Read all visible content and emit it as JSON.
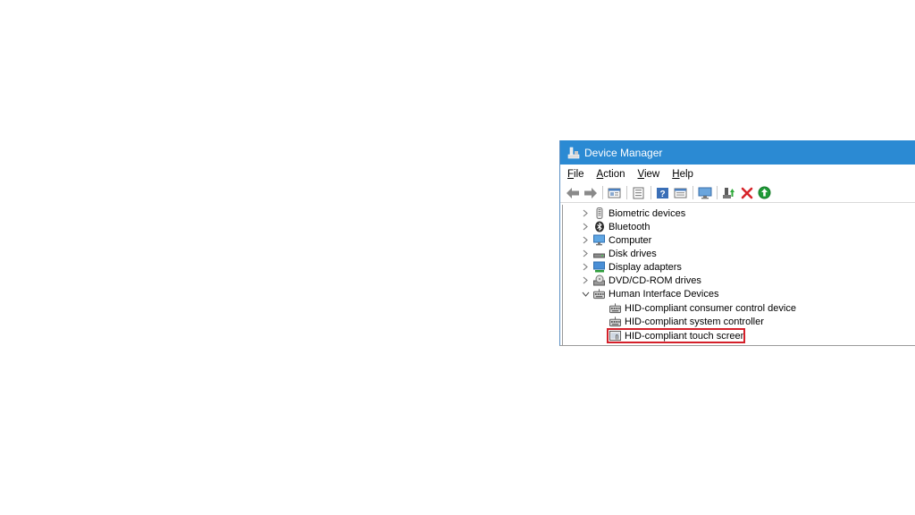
{
  "window": {
    "title": "Device Manager"
  },
  "menu": [
    {
      "accel": "F",
      "rest": "ile"
    },
    {
      "accel": "A",
      "rest": "ction"
    },
    {
      "accel": "V",
      "rest": "iew"
    },
    {
      "accel": "H",
      "rest": "elp"
    }
  ],
  "toolbar": [
    "back-arrow-icon",
    "forward-arrow-icon",
    "properties-view-icon",
    "update-list-icon",
    "help-icon",
    "device-view-icon",
    "monitor-scan-icon",
    "update-driver-icon",
    "uninstall-x-icon",
    "enable-device-icon"
  ],
  "tree": [
    {
      "label": "Biometric devices",
      "expanded": false,
      "level": 0,
      "icon": "biometric-icon"
    },
    {
      "label": "Bluetooth",
      "expanded": false,
      "level": 0,
      "icon": "bluetooth-icon"
    },
    {
      "label": "Computer",
      "expanded": false,
      "level": 0,
      "icon": "computer-icon"
    },
    {
      "label": "Disk drives",
      "expanded": false,
      "level": 0,
      "icon": "disk-drive-icon"
    },
    {
      "label": "Display adapters",
      "expanded": false,
      "level": 0,
      "icon": "display-adapter-icon"
    },
    {
      "label": "DVD/CD-ROM drives",
      "expanded": false,
      "level": 0,
      "icon": "dvd-drive-icon"
    },
    {
      "label": "Human Interface Devices",
      "expanded": true,
      "level": 0,
      "icon": "hid-icon"
    },
    {
      "label": "HID-compliant consumer control device",
      "level": 1,
      "icon": "hid-device-icon"
    },
    {
      "label": "HID-compliant system controller",
      "level": 1,
      "icon": "hid-device-icon"
    },
    {
      "label": "HID-compliant touch screen",
      "level": 1,
      "icon": "touch-screen-icon",
      "highlighted": true
    }
  ],
  "colors": {
    "titlebar": "#2b8ad3",
    "highlight_border": "#d4202a"
  }
}
